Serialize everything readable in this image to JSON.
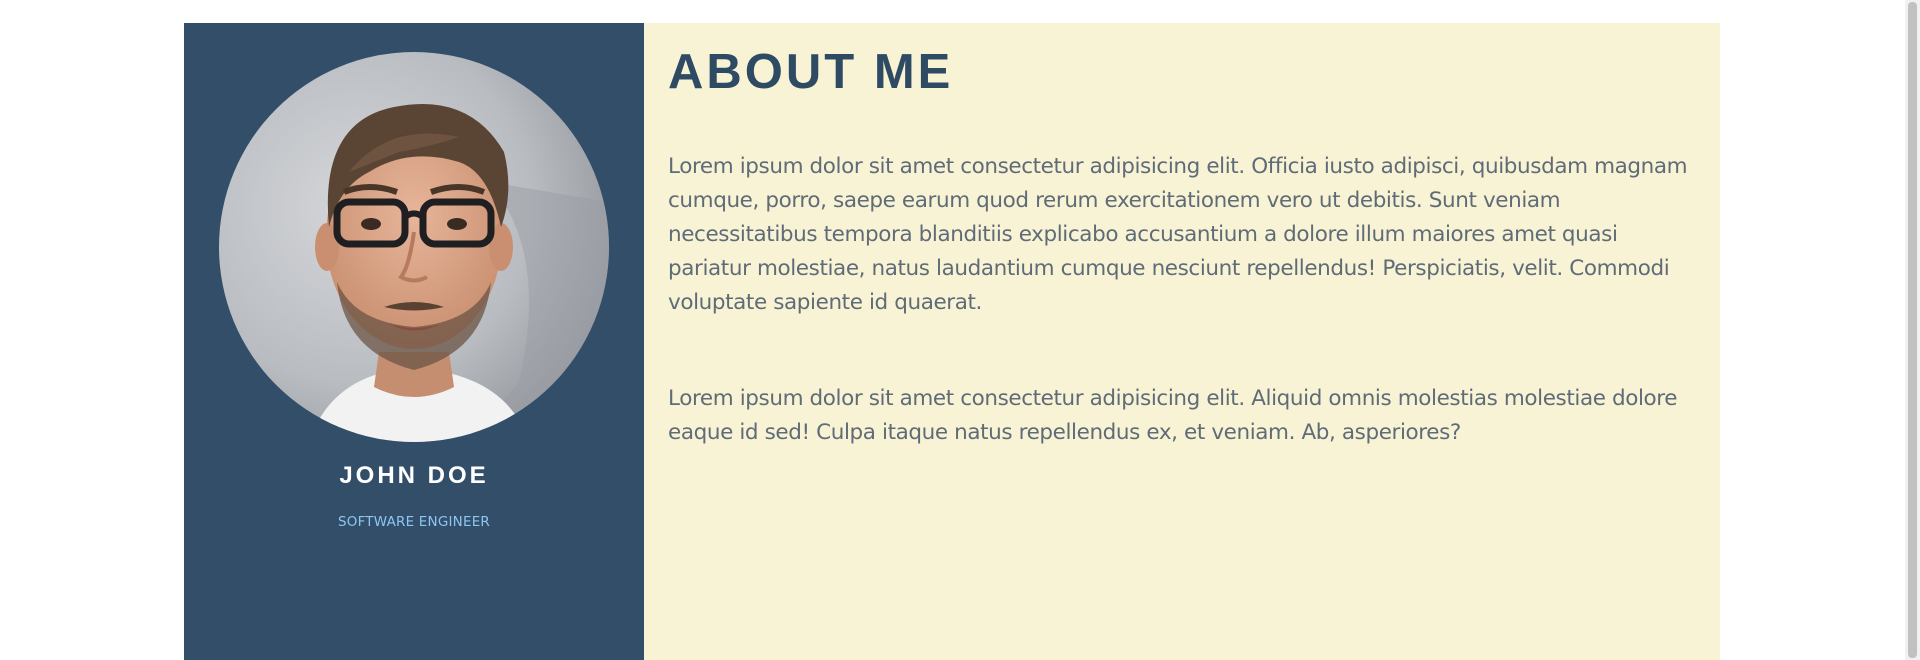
{
  "profile": {
    "photo_icon": "person-photo",
    "name": "JOHN DOE",
    "role": "SOFTWARE ENGINEER"
  },
  "about": {
    "title": "ABOUT ME",
    "paragraphs": [
      "Lorem ipsum dolor sit amet consectetur adipisicing elit. Officia iusto adipisci, quibusdam magnam cumque, porro, saepe earum quod rerum exercitationem vero ut debitis. Sunt veniam necessitatibus tempora blanditiis explicabo accusantium a dolore illum maiores amet quasi pariatur molestiae, natus laudantium cumque nesciunt repellendus! Perspiciatis, velit. Commodi voluptate sapiente id quaerat.",
      "Lorem ipsum dolor sit amet consectetur adipisicing elit. Aliquid omnis molestias molestiae dolore eaque id sed! Culpa itaque natus repellendus ex, et veniam. Ab, asperiores?"
    ]
  },
  "colors": {
    "sidebar": "#324e69",
    "content": "#f8f3d4",
    "title": "#2f4a63",
    "role": "#8ec6f2",
    "text": "#5f6c78"
  }
}
